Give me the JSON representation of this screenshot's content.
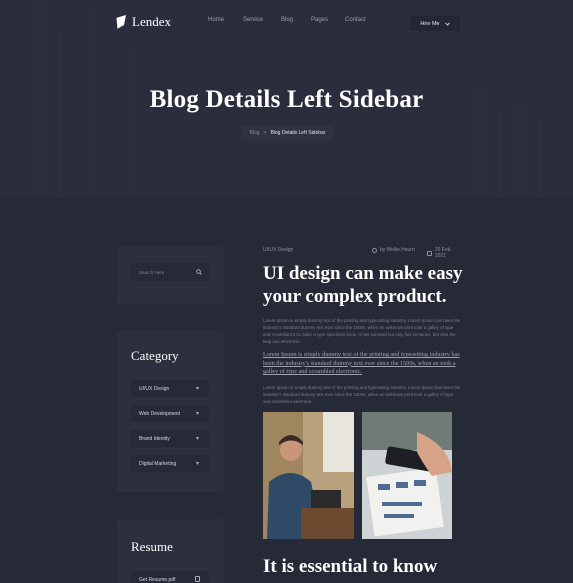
{
  "brand": {
    "name": "Lendex",
    "logo_icon": "feather-logo-icon"
  },
  "nav": {
    "items": [
      "Home",
      "Service",
      "Blog",
      "Pages",
      "Contact"
    ],
    "cta_label": "Hire Me",
    "cta_icon": "chevron-down-icon"
  },
  "hero": {
    "title": "Blog Details Left Sidebar",
    "breadcrumb": {
      "parent": "Blog",
      "separator": ">",
      "current": "Blog Details Left Sidebar"
    }
  },
  "sidebar": {
    "search": {
      "placeholder": "Search Here",
      "icon": "search-icon"
    },
    "category": {
      "title": "Category",
      "items": [
        "UI/UX Design",
        "Web Development",
        "Brand Identity",
        "Digital Marketing"
      ]
    },
    "resume": {
      "title": "Resume",
      "file_label": "Get Resume.pdf",
      "file_icon": "download-icon"
    }
  },
  "post": {
    "category": "UI/UX Design",
    "author": "by Mollie Hourn",
    "date": "26 Feb, 2021",
    "title": "UI design can make easy your complex product.",
    "paragraph_1": "Lorem Ipsum is simply dummy text of the printing and typesetting industry. Lorem Ipsum has been the industry's standard dummy text ever since the 1500s, when an unknown print took a galley of type and scrambled it to make a type specimen book. It has survived not only five centuries, but also the leap into electronic.",
    "quote": "Lorem Ipsum is simply dummy text of the printing and typesetting industry has been the industry's standard dummy text ever since the 1500s, when an took a galley of type and scrambled electronic.",
    "paragraph_2": "Lorem Ipsum is simply dummy text of the printing and typesetting industry. Lorem Ipsum has been the industry's standard dummy text ever since the 1500s, when an unknown print took a galley of type and scrambled electronic.",
    "subheading": "It is essential to know"
  },
  "colors": {
    "background": "#262936",
    "hero": "#2a2d3b",
    "card": "#2c2f3d",
    "input": "#262936",
    "heading": "#ffffff",
    "muted": "#7c7f8f"
  }
}
